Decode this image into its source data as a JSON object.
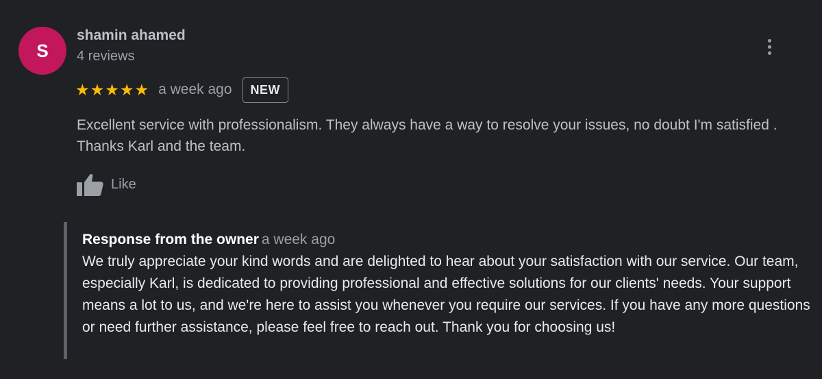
{
  "review": {
    "avatar_letter": "S",
    "author_name": "shamin ahamed",
    "review_count": "4 reviews",
    "rating": 5,
    "max_rating": 5,
    "date": "a week ago",
    "badge": "NEW",
    "text": "Excellent service with professionalism. They always have a way to resolve your issues, no doubt I'm satisfied . Thanks Karl and the team.",
    "like_label": "Like",
    "more_icon": "more-vertical-icon",
    "like_icon": "thumbs-up-icon"
  },
  "owner_response": {
    "title": "Response from the owner",
    "date": "a week ago",
    "text": "We truly appreciate your kind words and are delighted to hear about your satisfaction with our service. Our team, especially Karl, is dedicated to providing professional and effective solutions for our clients' needs. Your support means a lot to us, and we're here to assist you whenever you require our services. If you have any more questions or need further assistance, please feel free to reach out. Thank you for choosing us!"
  },
  "colors": {
    "background": "#202124",
    "avatar": "#c2185b",
    "star": "#fbbc04",
    "muted_text": "#9aa0a6",
    "response_bar": "#5f6368"
  }
}
